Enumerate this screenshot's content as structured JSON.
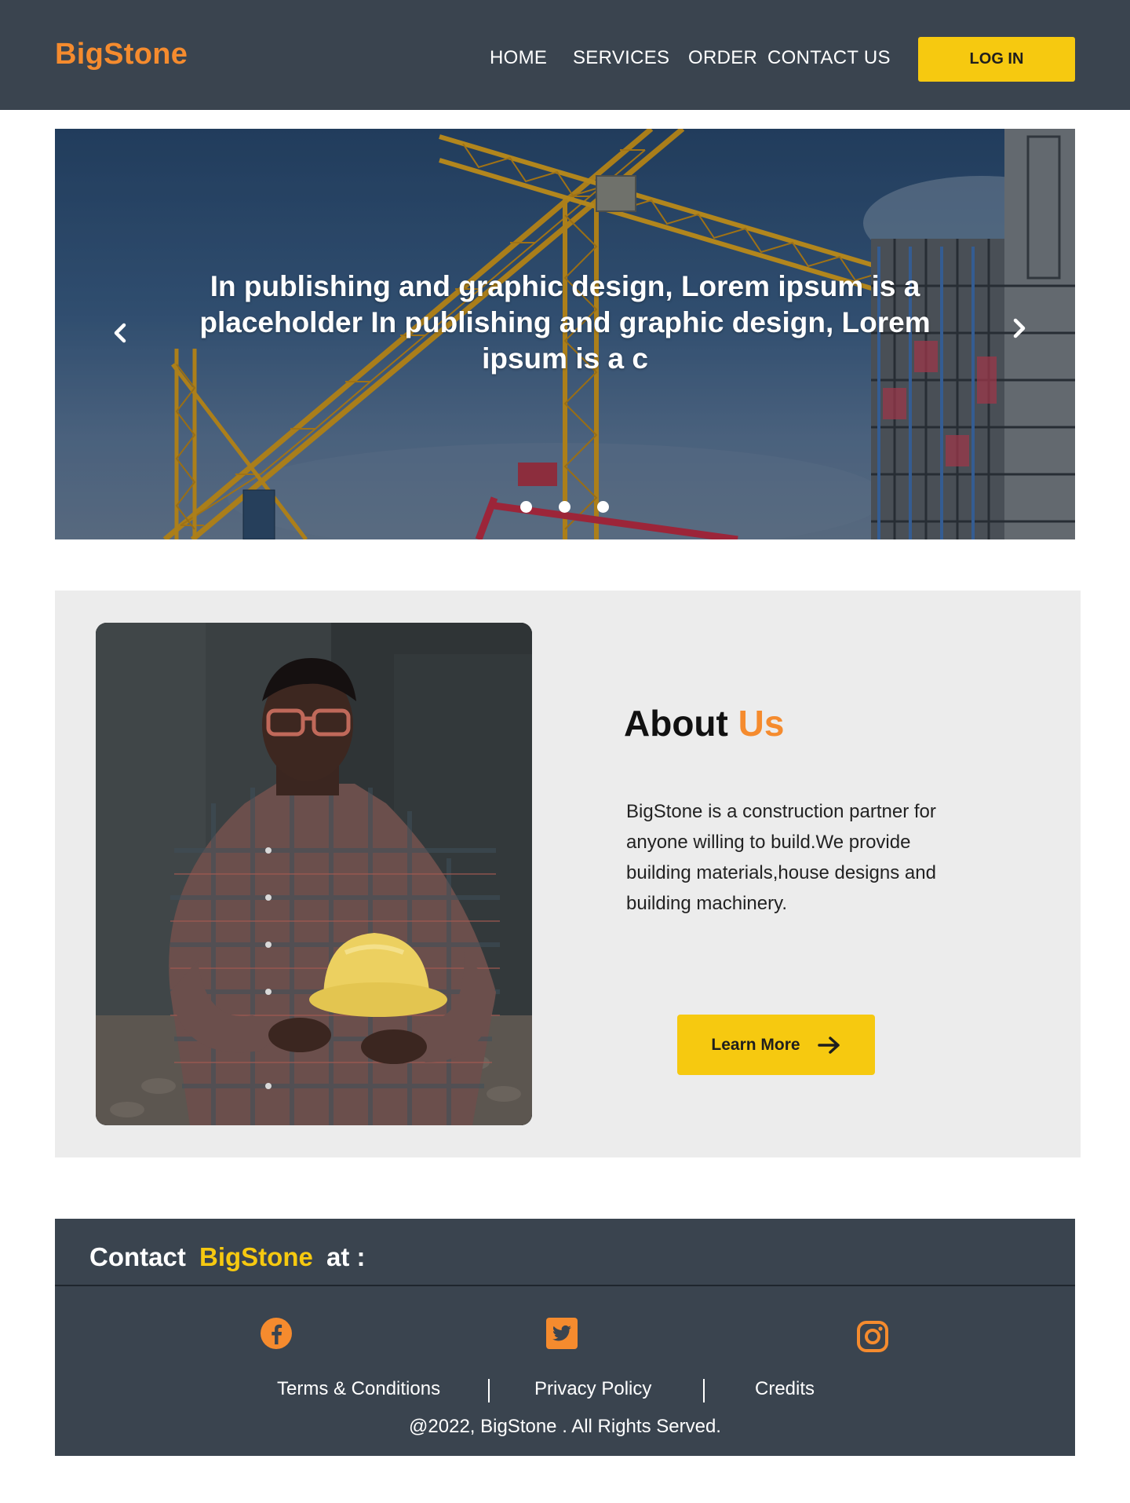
{
  "brand": {
    "name": "BigStone",
    "accent_color": "#f58b2e"
  },
  "nav": {
    "items": [
      {
        "label": "HOME"
      },
      {
        "label": "SERVICES"
      },
      {
        "label": "ORDER"
      },
      {
        "label": "CONTACT US"
      }
    ],
    "login_label": "LOG IN"
  },
  "hero": {
    "caption": "In publishing and graphic design, Lorem ipsum is a placeholder In publishing and graphic design, Lorem ipsum is a  c",
    "prev_icon": "chevron-left-icon",
    "next_icon": "chevron-right-icon",
    "slide_count": 3
  },
  "about": {
    "title_main": "About",
    "title_accent": "Us",
    "text": "BigStone is a construction partner for anyone willing to build.We provide building materials,house designs and building machinery.",
    "button_label": "Learn  More",
    "button_icon": "arrow-right-icon"
  },
  "footer": {
    "contact_prefix": "Contact",
    "contact_brand": "BigStone",
    "contact_suffix": "at :",
    "social": [
      "facebook-icon",
      "twitter-icon",
      "instagram-icon"
    ],
    "links": {
      "terms": "Terms & Conditions",
      "privacy": "Privacy Policy",
      "credits": "Credits"
    },
    "copyright": "@2022, BigStone . All Rights Served."
  },
  "colors": {
    "header_bg": "#3a444f",
    "button_yellow": "#f6c910",
    "about_bg": "#ececec"
  }
}
